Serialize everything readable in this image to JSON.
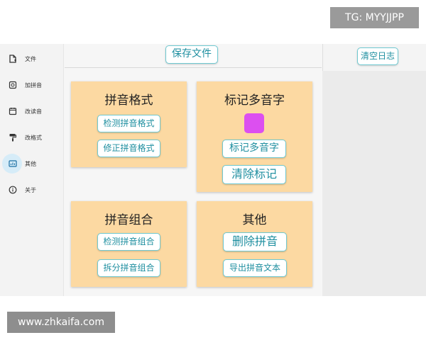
{
  "watermarks": {
    "top": "TG: MYYJJPP",
    "bottom": "www.zhkaifa.com"
  },
  "sidebar": {
    "items": [
      {
        "label": "文件",
        "icon": "file-icon"
      },
      {
        "label": "加拼音",
        "icon": "add-pinyin-icon"
      },
      {
        "label": "改读音",
        "icon": "calendar-edit-icon"
      },
      {
        "label": "改格式",
        "icon": "paint-roller-icon"
      },
      {
        "label": "其他",
        "icon": "other-icon",
        "active": true
      },
      {
        "label": "关于",
        "icon": "info-icon"
      }
    ]
  },
  "toolbar": {
    "save_label": "保存文件"
  },
  "log_panel": {
    "clear_label": "清空日志"
  },
  "cards": {
    "format": {
      "title": "拼音格式",
      "detect": "检测拼音格式",
      "fix": "修正拼音格式"
    },
    "poly": {
      "title": "标记多音字",
      "swatch_color": "#dc4ff0",
      "mark": "标记多音字",
      "clear": "清除标记"
    },
    "combo": {
      "title": "拼音组合",
      "detect": "检测拼音组合",
      "split": "拆分拼音组合"
    },
    "other": {
      "title": "其他",
      "delete": "删除拼音",
      "export": "导出拼音文本"
    }
  },
  "colors": {
    "card_bg": "#fcd9a2",
    "button_text": "#1f8fa0",
    "button_border": "#6fc9d1",
    "active_nav_bg": "#d6ecf8"
  }
}
